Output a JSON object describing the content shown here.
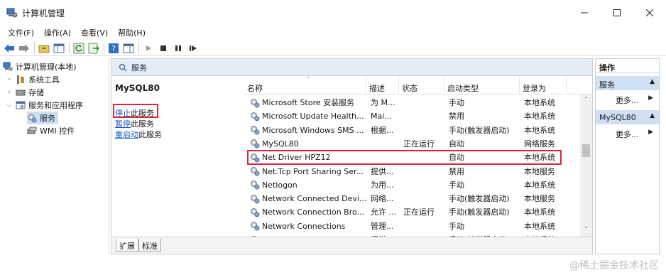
{
  "window": {
    "title": "计算机管理"
  },
  "menu": [
    "文件(F)",
    "操作(A)",
    "查看(V)",
    "帮助(H)"
  ],
  "tree": {
    "root": "计算机管理(本地)",
    "system_tools": "系统工具",
    "storage": "存储",
    "services_apps": "服务和应用程序",
    "services": "服务",
    "wmi": "WMI 控件"
  },
  "center": {
    "header": "服务",
    "extended": {
      "title": "MySQL80",
      "stop_link": "停止",
      "stop_suffix": "此服务",
      "pause_link": "暂停",
      "pause_suffix": "此服务",
      "restart_link": "重启动",
      "restart_suffix": "此服务"
    },
    "columns": {
      "name": "名称",
      "desc": "描述",
      "status": "状态",
      "startup": "启动类型",
      "logon": "登录为"
    },
    "rows": [
      {
        "name": "Microsoft Store 安装服务",
        "desc": "为 M...",
        "status": "",
        "startup": "手动",
        "logon": "本地系统"
      },
      {
        "name": "Microsoft Update Health...",
        "desc": "Mai...",
        "status": "",
        "startup": "禁用",
        "logon": "本地系统"
      },
      {
        "name": "Microsoft Windows SMS ...",
        "desc": "根据...",
        "status": "",
        "startup": "手动(触发器启动)",
        "logon": "本地系统"
      },
      {
        "name": "MySQL80",
        "desc": "",
        "status": "正在运行",
        "startup": "自动",
        "logon": "网络服务"
      },
      {
        "name": "Net Driver HPZ12",
        "desc": "",
        "status": "",
        "startup": "自动",
        "logon": "本地系统"
      },
      {
        "name": "Net.Tcp Port Sharing Ser...",
        "desc": "提供...",
        "status": "",
        "startup": "禁用",
        "logon": "本地服务"
      },
      {
        "name": "Netlogon",
        "desc": "为用...",
        "status": "",
        "startup": "手动",
        "logon": "本地系统"
      },
      {
        "name": "Network Connected Devi...",
        "desc": "网络...",
        "status": "",
        "startup": "手动(触发器启动)",
        "logon": "本地服务"
      },
      {
        "name": "Network Connection Bro...",
        "desc": "允许 ...",
        "status": "正在运行",
        "startup": "手动(触发器启动)",
        "logon": "本地系统"
      },
      {
        "name": "Network Connections",
        "desc": "管理...",
        "status": "",
        "startup": "手动",
        "logon": "本地系统"
      },
      {
        "name": "Network Connectivity Ass...",
        "desc": "提供...",
        "status": "",
        "startup": "手动(触发器启动)",
        "logon": "本地系统"
      }
    ],
    "tabs": [
      "扩展",
      "标准"
    ]
  },
  "actions": {
    "header": "操作",
    "group1": "服务",
    "more1": "更多...",
    "group2": "MySQL80",
    "more2": "更多..."
  },
  "watermark": "@稀土掘金技术社区",
  "colors": {
    "highlight_box": "#d7263d",
    "link": "#1a55c5",
    "header_bg": "#e3ecf7",
    "action_group_bg": "#cfe0f3"
  }
}
